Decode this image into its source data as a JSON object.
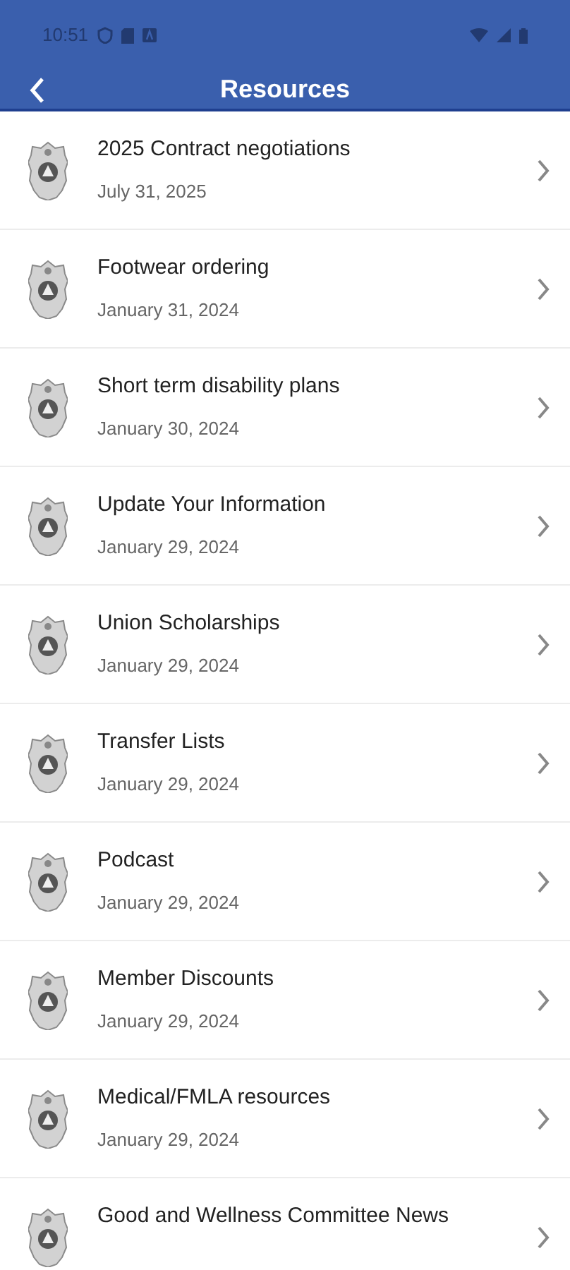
{
  "status_bar": {
    "time": "10:51"
  },
  "app_bar": {
    "title": "Resources"
  },
  "items": [
    {
      "title": "2025 Contract negotiations",
      "date": "July 31, 2025"
    },
    {
      "title": "Footwear ordering",
      "date": "January 31, 2024"
    },
    {
      "title": "Short term disability plans",
      "date": "January 30, 2024"
    },
    {
      "title": "Update Your Information",
      "date": "January 29, 2024"
    },
    {
      "title": "Union Scholarships",
      "date": "January 29, 2024"
    },
    {
      "title": "Transfer Lists",
      "date": "January 29, 2024"
    },
    {
      "title": "Podcast",
      "date": "January 29, 2024"
    },
    {
      "title": "Member Discounts",
      "date": "January 29, 2024"
    },
    {
      "title": "Medical/FMLA resources",
      "date": "January 29, 2024"
    },
    {
      "title": "Good and Wellness Committee News"
    }
  ]
}
